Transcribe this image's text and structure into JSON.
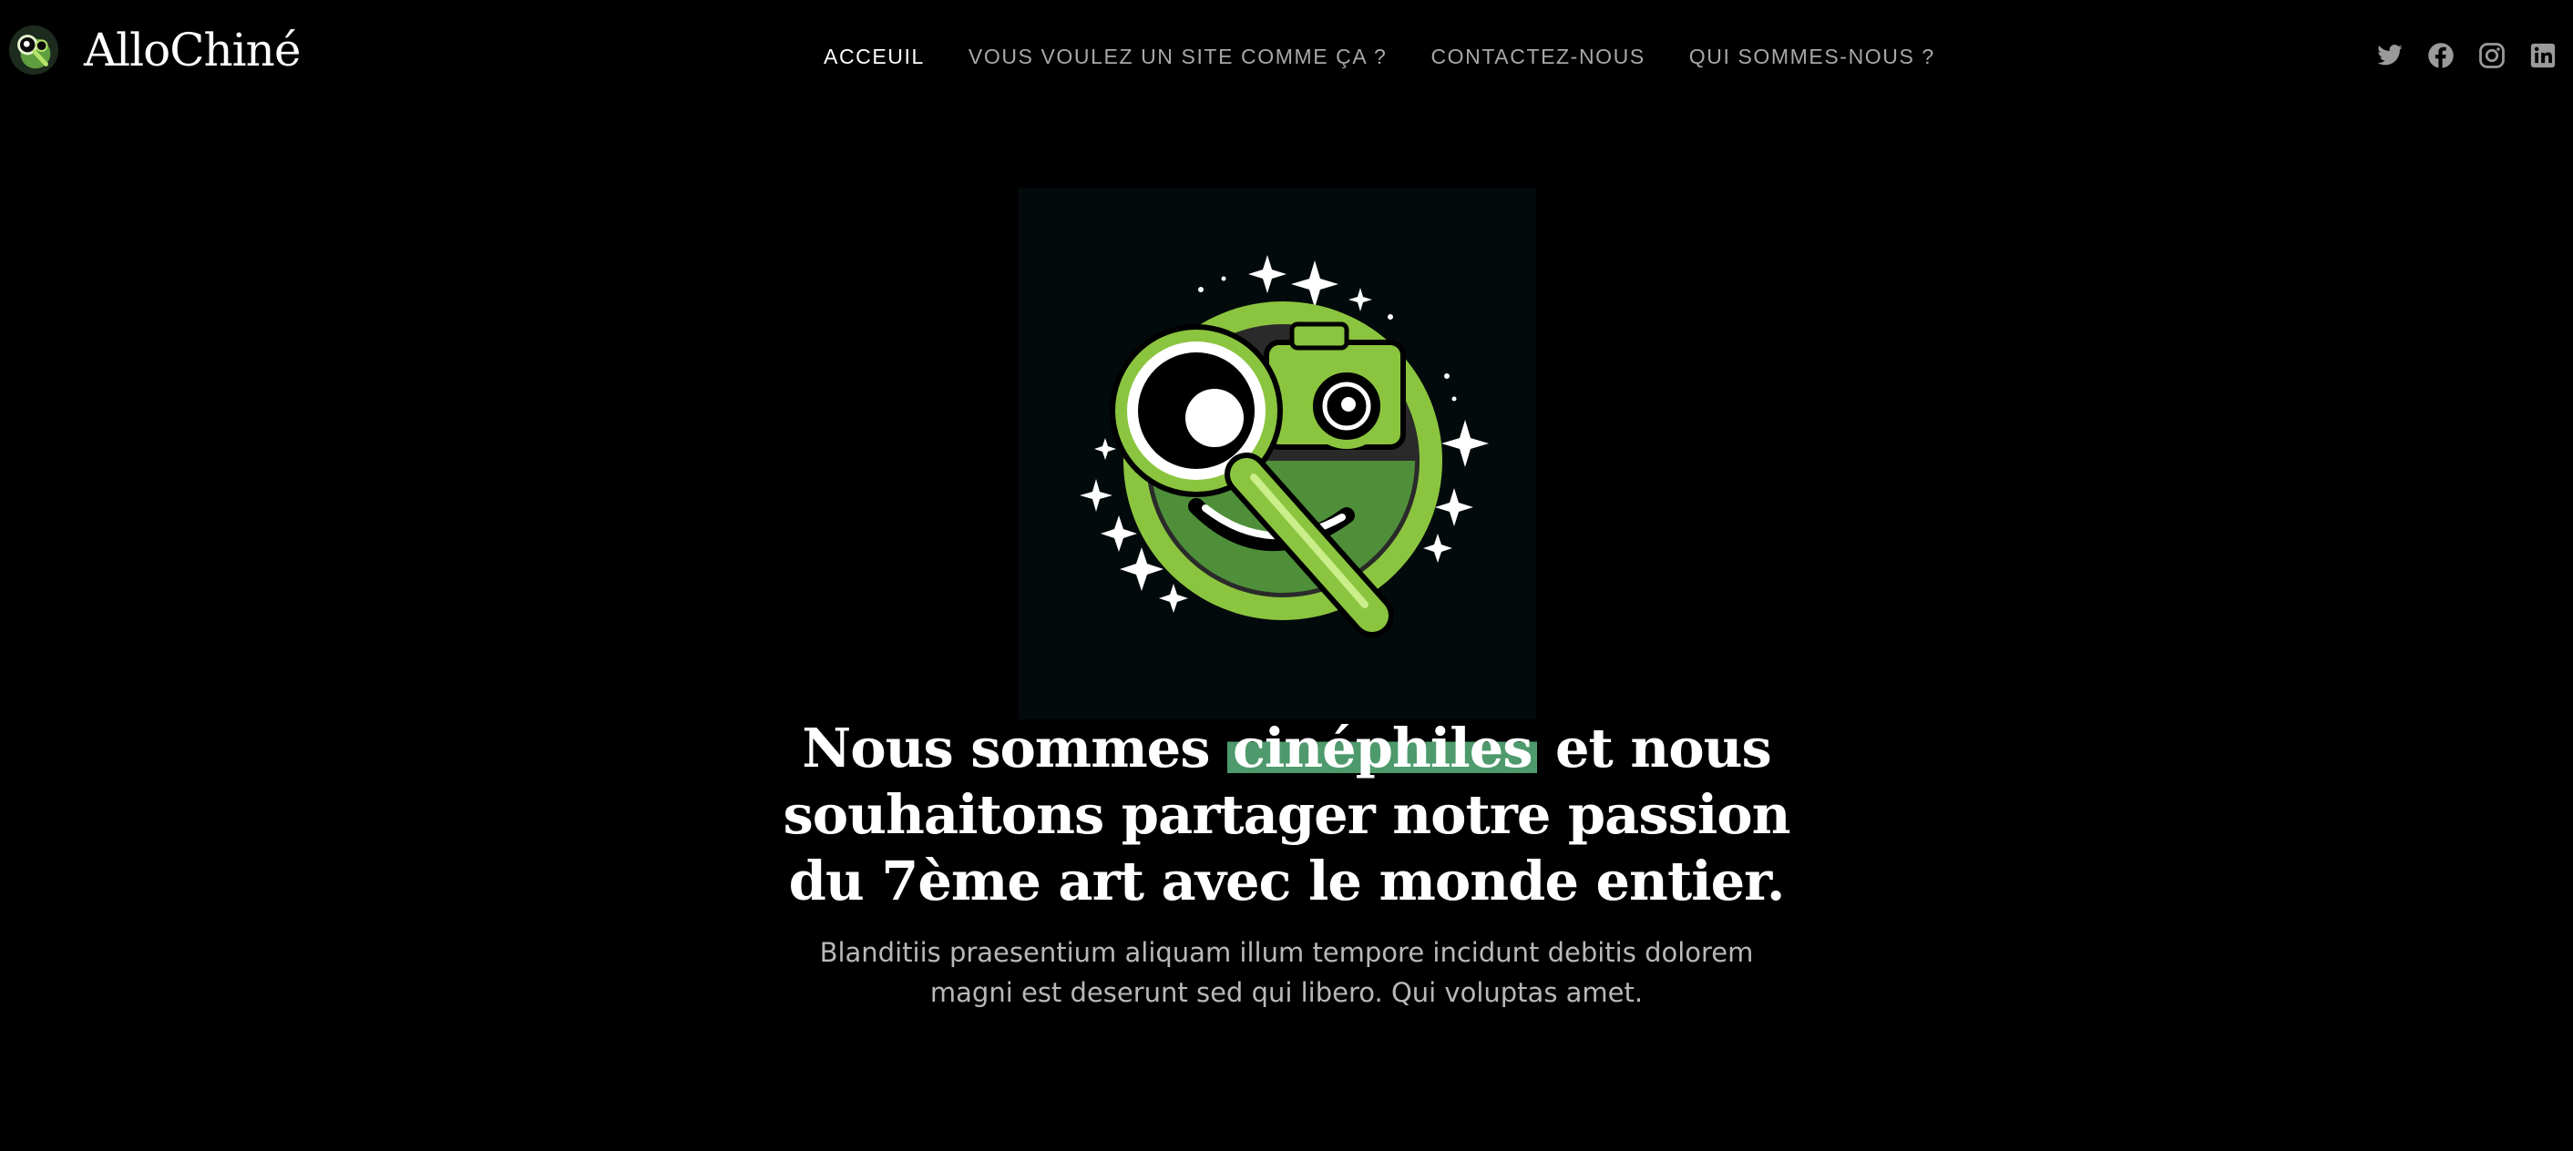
{
  "brand": {
    "name": "AlloChiné",
    "logo_icon": "magnifier-camera-mascot-icon",
    "accent_color": "#8bc53f",
    "highlight_color": "#4e9a6c"
  },
  "nav": {
    "items": [
      {
        "label": "ACCEUIL",
        "active": true
      },
      {
        "label": "VOUS VOULEZ UN SITE COMME ÇA ?",
        "active": false
      },
      {
        "label": "CONTACTEZ-NOUS",
        "active": false
      },
      {
        "label": "QUI SOMMES-NOUS ?",
        "active": false
      }
    ]
  },
  "socials": [
    {
      "name": "twitter-icon"
    },
    {
      "name": "facebook-icon"
    },
    {
      "name": "instagram-icon"
    },
    {
      "name": "linkedin-icon"
    }
  ],
  "hero": {
    "title_before": "Nous sommes ",
    "title_highlight": "cinéphiles",
    "title_after": " et nous souhaitons partager notre passion du 7ème art avec le monde entier.",
    "subtitle": "Blanditiis praesentium aliquam illum tempore incidunt debitis dolorem magni est deserunt sed qui libero. Qui voluptas amet."
  }
}
